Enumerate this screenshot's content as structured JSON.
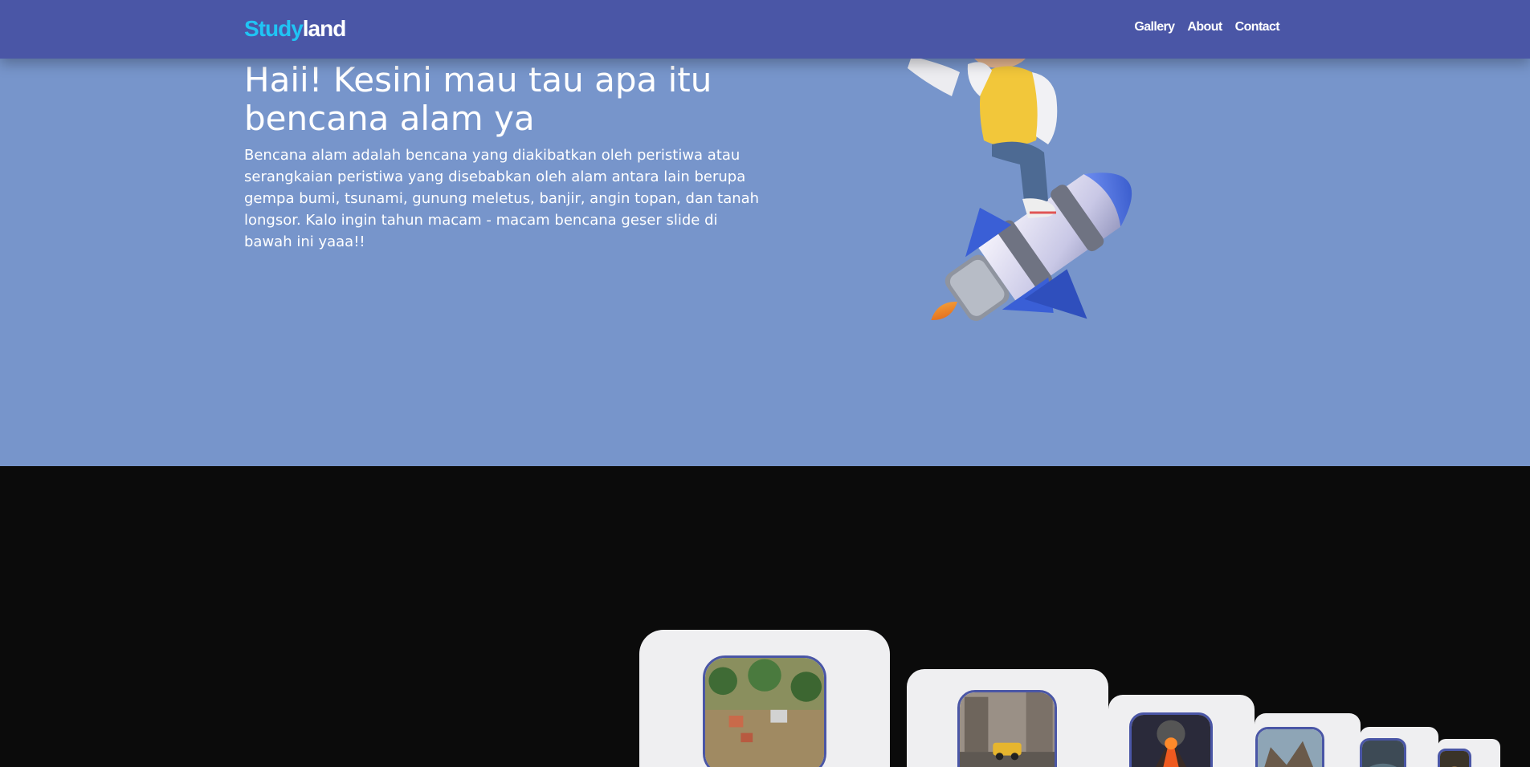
{
  "navbar": {
    "logo_part1": "Study",
    "logo_part2": "land",
    "links": [
      "Gallery",
      "About",
      "Contact"
    ]
  },
  "hero": {
    "title": "Haii! Kesini mau tau apa itu bencana alam ya",
    "description": "Bencana alam adalah bencana yang diakibatkan oleh peristiwa atau serangkaian peristiwa yang disebabkan oleh alam antara lain berupa gempa bumi, tsunami, gunung meletus, banjir, angin topan, dan tanah longsor. Kalo ingin tahun macam - macam bencana geser slide di bawah ini yaaa!!",
    "illustration": "boy-riding-rocket-illustration"
  },
  "gallery": {
    "cards": [
      {
        "image": "flood-image"
      },
      {
        "image": "earthquake-image"
      },
      {
        "image": "volcano-image"
      },
      {
        "image": "landslide-image"
      },
      {
        "image": "tsunami-image"
      },
      {
        "image": "storm-image"
      }
    ]
  },
  "colors": {
    "navbar": "#4a56a6",
    "hero_bg": "#7795cb",
    "logo_accent": "#20c4f4",
    "gallery_bg": "#0b0b0b",
    "card_bg": "#efeff1"
  }
}
